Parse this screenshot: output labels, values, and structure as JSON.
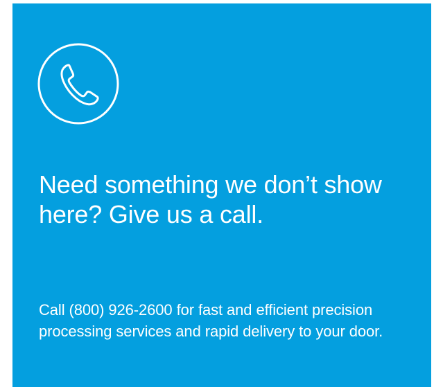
{
  "colors": {
    "card_background": "#049fdf",
    "text": "#ffffff"
  },
  "card": {
    "icon": "phone-icon",
    "headline": "Need something we don’t show here? Give us a call.",
    "body": "Call (800) 926-2600 for fast and efficient precision processing services and rapid delivery to your door."
  }
}
